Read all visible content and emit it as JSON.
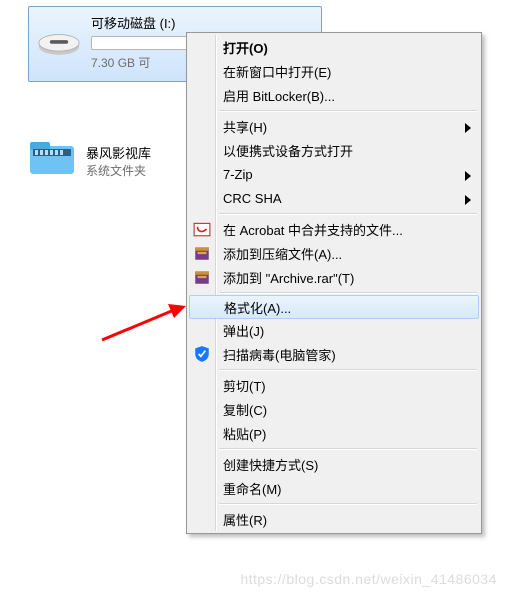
{
  "drive": {
    "label": "可移动磁盘 (I:)",
    "sub": "7.30 GB 可"
  },
  "folder": {
    "label": "暴风影视库",
    "sub": "系统文件夹"
  },
  "menu": {
    "open": "打开(O)",
    "open_new": "在新窗口中打开(E)",
    "bitlocker": "启用 BitLocker(B)...",
    "share": "共享(H)",
    "portable": "以便携式设备方式打开",
    "sevenzip": "7-Zip",
    "crc": "CRC SHA",
    "acrobat": "在 Acrobat 中合并支持的文件...",
    "compress": "添加到压缩文件(A)...",
    "archive": "添加到 \"Archive.rar\"(T)",
    "format": "格式化(A)...",
    "eject": "弹出(J)",
    "scan": "扫描病毒(电脑管家)",
    "cut": "剪切(T)",
    "copy": "复制(C)",
    "paste": "粘贴(P)",
    "shortcut": "创建快捷方式(S)",
    "rename": "重命名(M)",
    "properties": "属性(R)"
  },
  "watermark": "https://blog.csdn.net/weixin_41486034"
}
